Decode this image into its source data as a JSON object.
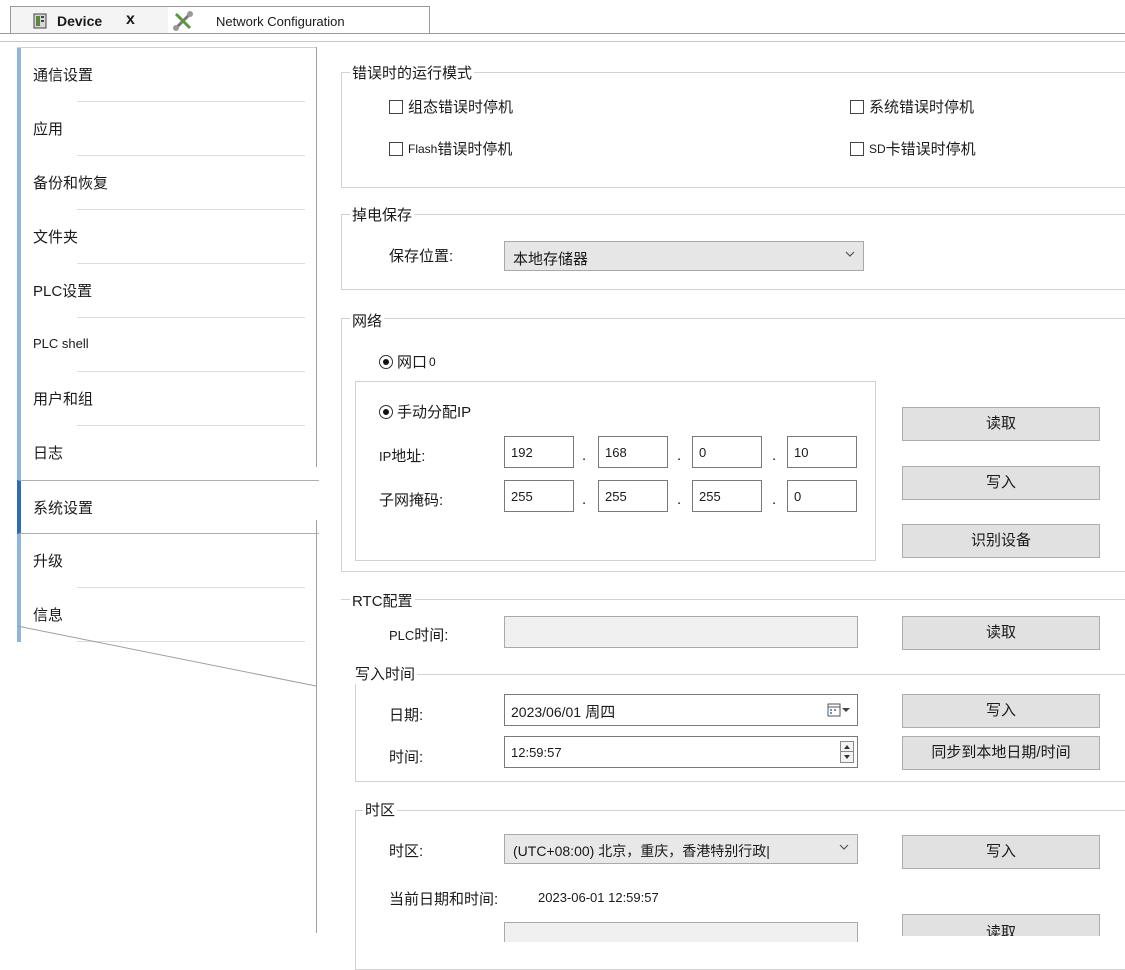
{
  "tabs": [
    {
      "label": "Device",
      "close": "x"
    },
    {
      "label": "Network Configuration"
    }
  ],
  "sidebar": {
    "items": [
      {
        "label": "通信设置"
      },
      {
        "label": "应用"
      },
      {
        "label": "备份和恢复"
      },
      {
        "label": "文件夹"
      },
      {
        "label": "PLC设置"
      },
      {
        "label": "PLC shell"
      },
      {
        "label": "用户和组"
      },
      {
        "label": "日志"
      },
      {
        "label": "系统设置",
        "selected": true
      },
      {
        "label": "升级"
      },
      {
        "label": "信息"
      }
    ]
  },
  "error_mode": {
    "title": "错误时的运行模式",
    "config_error_stop": "组态错误时停机",
    "system_error_stop": "系统错误时停机",
    "flash_prefix": "Flash",
    "flash_error_stop": "错误时停机",
    "sd_prefix": "SD",
    "sd_error_stop": "卡错误时停机"
  },
  "power_save": {
    "title": "掉电保存",
    "location_label": "保存位置:",
    "location_value": "本地存储器"
  },
  "network": {
    "title": "网络",
    "port_label": "网口",
    "port_number": "0",
    "manual_ip": "手动分配IP",
    "ip_label_prefix": "IP",
    "ip_label_suffix": "地址:",
    "mask_label": "子网掩码:",
    "ip": [
      "192",
      "168",
      "0",
      "10"
    ],
    "mask": [
      "255",
      "255",
      "255",
      "0"
    ],
    "dot": ".",
    "read_button": "读取",
    "write_button": "写入",
    "identify_button": "识别设备"
  },
  "rtc": {
    "title": "RTC配置",
    "plc_time_prefix": "PLC",
    "plc_time_label": "时间:",
    "plc_time_value": "",
    "read_button": "读取",
    "write_time": {
      "title": "写入时间",
      "date_label": "日期:",
      "date_value": "2023/06/01",
      "weekday": "周四",
      "time_label": "时间:",
      "time_value": "12:59:57",
      "write_button": "写入",
      "sync_button": "同步到本地日期/时间"
    }
  },
  "timezone": {
    "title": "时区",
    "label": "时区:",
    "value": "(UTC+08:00) 北京，重庆，香港特别行政|",
    "write_button": "写入",
    "current_label": "当前日期和时间:",
    "current_value": "2023-06-01 12:59:57",
    "read_button": "读取"
  },
  "colors": {
    "accent_selected": "#2d6db4",
    "accent_nav": "#8fb4dd",
    "button_bg": "#e1e1e1"
  }
}
